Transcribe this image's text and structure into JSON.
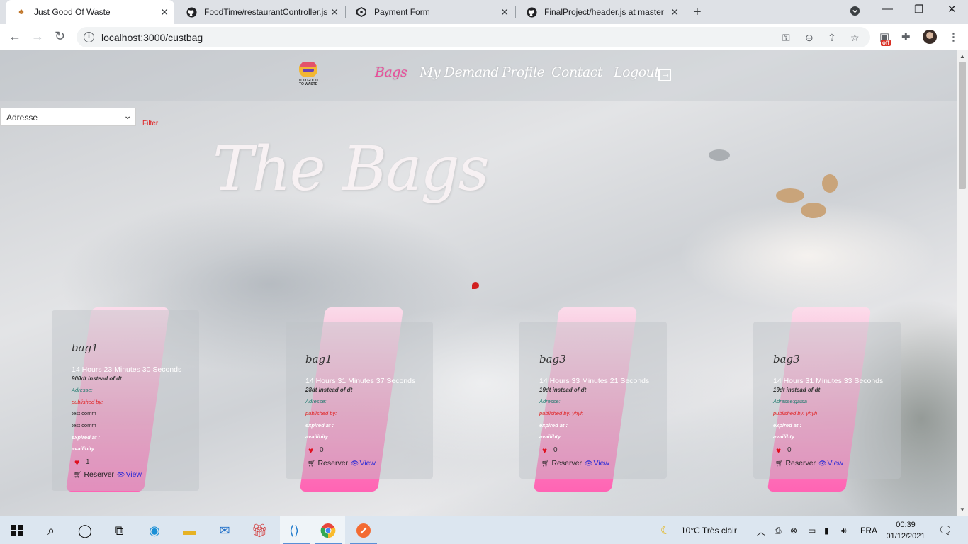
{
  "browser": {
    "tabs": [
      {
        "title": "Just Good Of Waste",
        "active": true,
        "favicon": "site-favicon"
      },
      {
        "title": "FoodTime/restaurantController.js",
        "active": false,
        "favicon": "github-icon"
      },
      {
        "title": "Payment Form",
        "active": false,
        "favicon": "codesandbox-icon"
      },
      {
        "title": "FinalProject/header.js at master",
        "active": false,
        "favicon": "github-icon"
      }
    ],
    "url": "localhost:3000/custbag",
    "extension_badge": "off"
  },
  "site": {
    "logo_text": "TOO GOOD TO WASTE",
    "nav": [
      {
        "label": "Bags",
        "active": true
      },
      {
        "label": "My Demand",
        "active": false
      },
      {
        "label": "Profile",
        "active": false
      },
      {
        "label": "Contact",
        "active": false
      },
      {
        "label": "Logout",
        "active": false
      }
    ],
    "filter": {
      "select_value": "Adresse",
      "button_label": "Filter"
    },
    "page_title": "The Bags",
    "accent_color": "#e84f9a"
  },
  "bags": [
    {
      "name": "bag1",
      "time": "14 Hours 23 Minutes 30 Seconds",
      "price": "900dt instead of dt",
      "address": "Adresse:",
      "published_by": "published by:",
      "comments": [
        "test comm",
        "test comm"
      ],
      "expired": "expired at :",
      "availability": "availibity :",
      "likes": "1",
      "reserve": "Reserver",
      "view": "View"
    },
    {
      "name": "bag1",
      "time": "14 Hours 31 Minutes 37 Seconds",
      "price": "28dt instead of dt",
      "address": "Adresse:",
      "published_by": "published by:",
      "comments": [],
      "expired": "expired at :",
      "availability": "availibity :",
      "likes": "0",
      "reserve": "Reserver",
      "view": "View"
    },
    {
      "name": "bag3",
      "time": "14 Hours 33 Minutes 21 Seconds",
      "price": "19dt instead of dt",
      "address": "Adresse:",
      "published_by": "published by: yhyh",
      "comments": [],
      "expired": "expired at :",
      "availability": "availibty :",
      "likes": "0",
      "reserve": "Reserver",
      "view": "View"
    },
    {
      "name": "bag3",
      "time": "14 Hours 31 Minutes 33 Seconds",
      "price": "19dt instead of dt",
      "address": "Adresse:gafsa",
      "published_by": "published by: yhyh",
      "comments": [],
      "expired": "expired at :",
      "availability": "availibty :",
      "likes": "0",
      "reserve": "Reserver",
      "view": "View"
    }
  ],
  "taskbar": {
    "weather": "10°C  Très clair",
    "language": "FRA",
    "time": "00:39",
    "date": "01/12/2021"
  }
}
